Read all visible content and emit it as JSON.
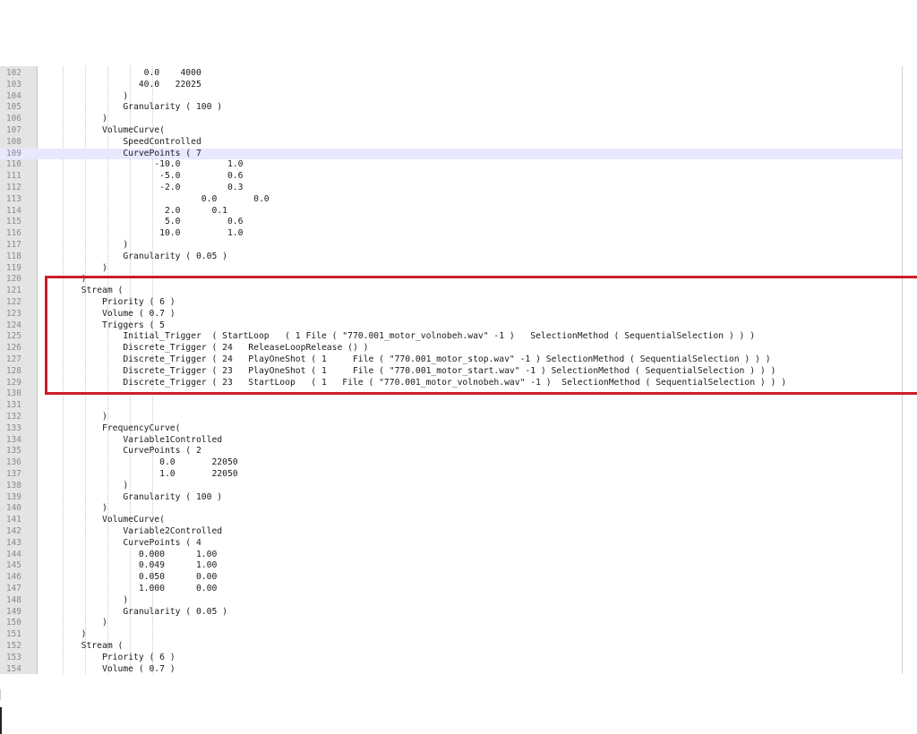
{
  "editor": {
    "current_line": 109,
    "lines": [
      {
        "n": "102",
        "t": "                    0.0    4000"
      },
      {
        "n": "103",
        "t": "                   40.0   22025"
      },
      {
        "n": "104",
        "t": "                )"
      },
      {
        "n": "105",
        "t": "                Granularity ( 100 )"
      },
      {
        "n": "106",
        "t": "            )"
      },
      {
        "n": "107",
        "t": "            VolumeCurve("
      },
      {
        "n": "108",
        "t": "                SpeedControlled"
      },
      {
        "n": "109",
        "t": "                CurvePoints ( 7"
      },
      {
        "n": "110",
        "t": "                      -10.0         1.0"
      },
      {
        "n": "111",
        "t": "                       -5.0         0.6"
      },
      {
        "n": "112",
        "t": "                       -2.0         0.3"
      },
      {
        "n": "113",
        "t": "                               0.0       0.0"
      },
      {
        "n": "114",
        "t": "                        2.0      0.1"
      },
      {
        "n": "115",
        "t": "                        5.0         0.6"
      },
      {
        "n": "116",
        "t": "                       10.0         1.0"
      },
      {
        "n": "117",
        "t": "                )"
      },
      {
        "n": "118",
        "t": "                Granularity ( 0.05 )"
      },
      {
        "n": "119",
        "t": "            )"
      },
      {
        "n": "120",
        "t": "        )"
      },
      {
        "n": "121",
        "t": "        Stream ("
      },
      {
        "n": "122",
        "t": "            Priority ( 6 )"
      },
      {
        "n": "123",
        "t": "            Volume ( 0.7 )"
      },
      {
        "n": "124",
        "t": "            Triggers ( 5"
      },
      {
        "n": "125",
        "t": "                Initial_Trigger  ( StartLoop   ( 1 File ( \"770.001_motor_volnobeh.wav\" -1 )   SelectionMethod ( SequentialSelection ) ) )"
      },
      {
        "n": "126",
        "t": "                Discrete_Trigger ( 24   ReleaseLoopRelease () )"
      },
      {
        "n": "127",
        "t": "                Discrete_Trigger ( 24   PlayOneShot ( 1     File ( \"770.001_motor_stop.wav\" -1 ) SelectionMethod ( SequentialSelection ) ) )"
      },
      {
        "n": "128",
        "t": "                Discrete_Trigger ( 23   PlayOneShot ( 1     File ( \"770.001_motor_start.wav\" -1 ) SelectionMethod ( SequentialSelection ) ) )"
      },
      {
        "n": "129",
        "t": "                Discrete_Trigger ( 23   StartLoop   ( 1   File ( \"770.001_motor_volnobeh.wav\" -1 )  SelectionMethod ( SequentialSelection ) ) )"
      },
      {
        "n": "130",
        "t": ""
      },
      {
        "n": "131",
        "t": ""
      },
      {
        "n": "132",
        "t": "            )"
      },
      {
        "n": "133",
        "t": "            FrequencyCurve("
      },
      {
        "n": "134",
        "t": "                Variable1Controlled"
      },
      {
        "n": "135",
        "t": "                CurvePoints ( 2"
      },
      {
        "n": "136",
        "t": "                       0.0       22050"
      },
      {
        "n": "137",
        "t": "                       1.0       22050"
      },
      {
        "n": "138",
        "t": "                )"
      },
      {
        "n": "139",
        "t": "                Granularity ( 100 )"
      },
      {
        "n": "140",
        "t": "            )"
      },
      {
        "n": "141",
        "t": "            VolumeCurve("
      },
      {
        "n": "142",
        "t": "                Variable2Controlled"
      },
      {
        "n": "143",
        "t": "                CurvePoints ( 4"
      },
      {
        "n": "144",
        "t": "                   0.000      1.00"
      },
      {
        "n": "145",
        "t": "                   0.049      1.00"
      },
      {
        "n": "146",
        "t": "                   0.050      0.00"
      },
      {
        "n": "147",
        "t": "                   1.000      0.00"
      },
      {
        "n": "148",
        "t": "                )"
      },
      {
        "n": "149",
        "t": "                Granularity ( 0.05 )"
      },
      {
        "n": "150",
        "t": "            )"
      },
      {
        "n": "151",
        "t": "        )"
      },
      {
        "n": "152",
        "t": "        Stream ("
      },
      {
        "n": "153",
        "t": "            Priority ( 6 )"
      },
      {
        "n": "154",
        "t": "            Volume ( 0.7 )"
      }
    ]
  },
  "annotation": {
    "highlight_color": "#c81e28",
    "highlighted_lines": "121-129"
  }
}
